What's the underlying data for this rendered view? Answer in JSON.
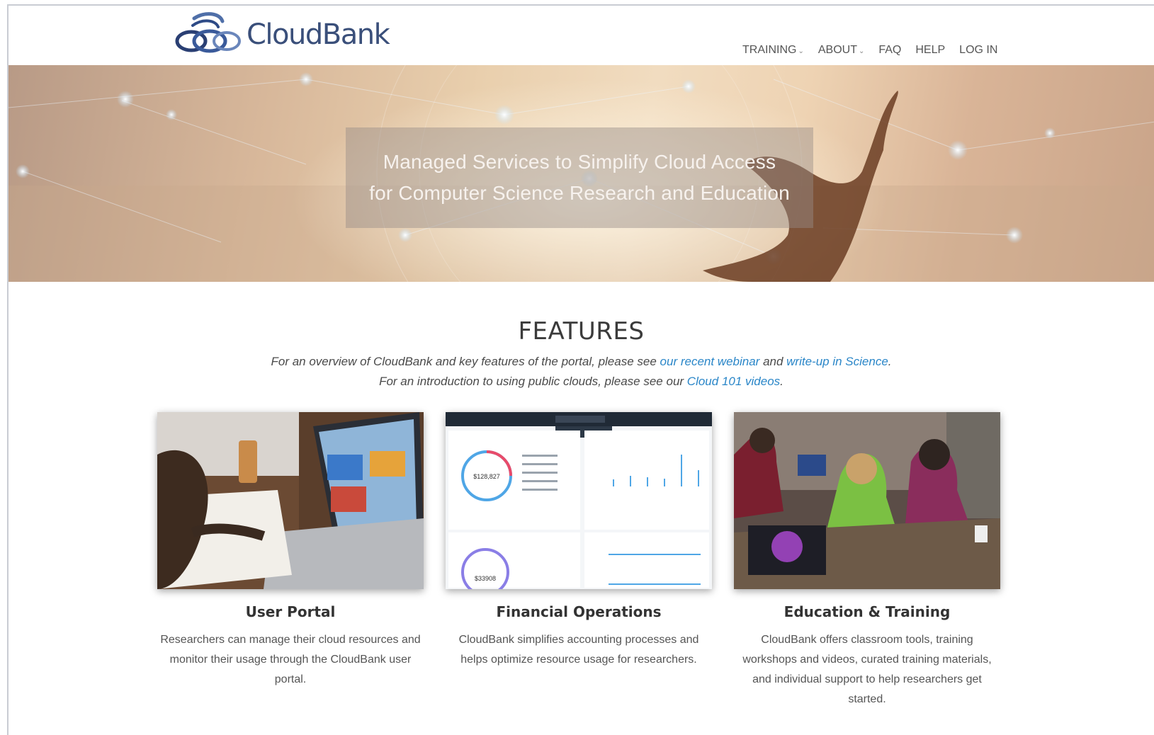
{
  "header": {
    "logo_text": "CloudBank",
    "nav": [
      {
        "label": "TRAINING",
        "has_dropdown": true
      },
      {
        "label": "ABOUT",
        "has_dropdown": true
      },
      {
        "label": "FAQ",
        "has_dropdown": false
      },
      {
        "label": "HELP",
        "has_dropdown": false
      },
      {
        "label": "LOG IN",
        "has_dropdown": false
      }
    ]
  },
  "hero": {
    "line1": "Managed Services to Simplify Cloud Access",
    "line2": "for Computer Science Research and Education"
  },
  "features": {
    "title": "FEATURES",
    "intro1_pre": "For an overview of CloudBank and key features of the portal, please see ",
    "intro1_link1": "our recent webinar",
    "intro1_mid": " and ",
    "intro1_link2": "write-up in Science",
    "intro1_post": ".",
    "intro2_pre": "For an introduction to using public clouds, please see our ",
    "intro2_link": "Cloud 101 videos",
    "intro2_post": ".",
    "cards": [
      {
        "title": "User Portal",
        "desc": "Researchers can manage their cloud resources and monitor their usage through the CloudBank user portal."
      },
      {
        "title": "Financial Operations",
        "desc": "CloudBank simplifies accounting processes and helps optimize resource usage for researchers."
      },
      {
        "title": "Education & Training",
        "desc": "CloudBank offers classroom tools, training workshops and videos, curated training materials, and individual support to help researchers get started."
      }
    ],
    "dashboard": {
      "total1": "$128,827",
      "total2": "$33908"
    }
  },
  "colors": {
    "link": "#2a86c8",
    "logo": "#3a4f7a"
  }
}
